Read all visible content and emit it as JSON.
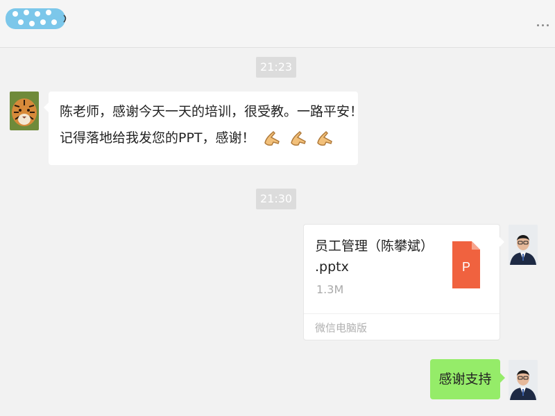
{
  "header": {
    "contact_name_icon": "obscured-name-sticker",
    "more_icon": "more-dots-icon"
  },
  "messages": [
    {
      "type": "time",
      "text": "21:23"
    },
    {
      "type": "incoming-text",
      "avatar_icon": "tiger-avatar",
      "line1": "陈老师，感谢今天一天的培训，很受教。一路平安！",
      "line2": "记得落地给我发您的PPT，感谢！",
      "emoji_icon": "pointing-hand-emoji",
      "emoji_count": 3
    },
    {
      "type": "time",
      "text": "21:30"
    },
    {
      "type": "outgoing-file",
      "avatar_icon": "man-in-suit-avatar",
      "file_name_line1": "员工管理（陈攀斌）",
      "file_name_line2": ".pptx",
      "file_size": "1.3M",
      "file_icon": "ppt-file-icon",
      "file_icon_letter": "P",
      "source": "微信电脑版"
    },
    {
      "type": "outgoing-text",
      "avatar_icon": "man-in-suit-avatar",
      "text": "感谢支持"
    }
  ],
  "colors": {
    "background": "#f2f2f2",
    "outgoing_bubble": "#95ec69",
    "incoming_bubble": "#ffffff",
    "time_badge": "#dcdcdc",
    "ppt_icon": "#f0623f"
  }
}
